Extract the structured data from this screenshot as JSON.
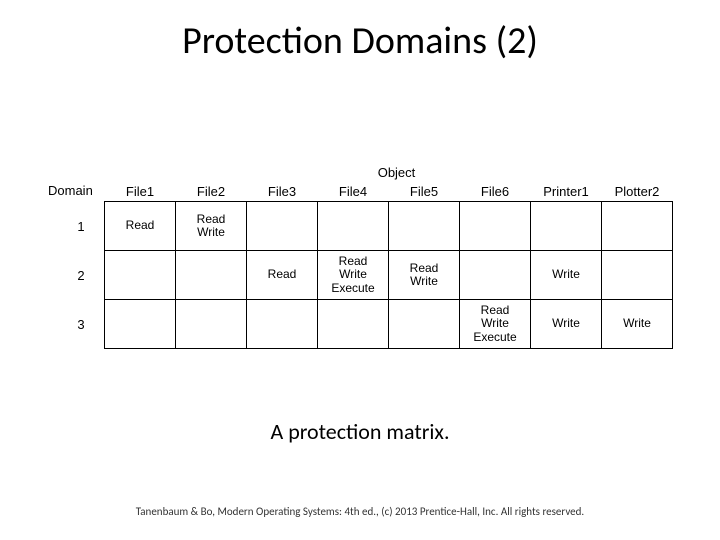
{
  "title": "Protection Domains (2)",
  "labels": {
    "object": "Object",
    "domain": "Domain"
  },
  "columns": [
    "File1",
    "File2",
    "File3",
    "File4",
    "File5",
    "File6",
    "Printer1",
    "Plotter2"
  ],
  "rows": [
    {
      "name": "1",
      "cells": [
        "Read",
        "Read\nWrite",
        "",
        "",
        "",
        "",
        "",
        ""
      ]
    },
    {
      "name": "2",
      "cells": [
        "",
        "",
        "Read",
        "Read\nWrite\nExecute",
        "Read\nWrite",
        "",
        "Write",
        ""
      ]
    },
    {
      "name": "3",
      "cells": [
        "",
        "",
        "",
        "",
        "",
        "Read\nWrite\nExecute",
        "Write",
        "Write"
      ]
    }
  ],
  "caption": "A protection matrix.",
  "footer": "Tanenbaum & Bo, Modern Operating Systems: 4th ed., (c) 2013 Prentice-Hall, Inc. All rights reserved.",
  "chart_data": {
    "type": "table",
    "title": "Protection matrix",
    "row_label": "Domain",
    "col_label": "Object",
    "columns": [
      "File1",
      "File2",
      "File3",
      "File4",
      "File5",
      "File6",
      "Printer1",
      "Plotter2"
    ],
    "rows": [
      "1",
      "2",
      "3"
    ],
    "cells": [
      [
        "Read",
        "Read Write",
        "",
        "",
        "",
        "",
        "",
        ""
      ],
      [
        "",
        "",
        "Read",
        "Read Write Execute",
        "Read Write",
        "",
        "Write",
        ""
      ],
      [
        "",
        "",
        "",
        "",
        "",
        "Read Write Execute",
        "Write",
        "Write"
      ]
    ]
  }
}
